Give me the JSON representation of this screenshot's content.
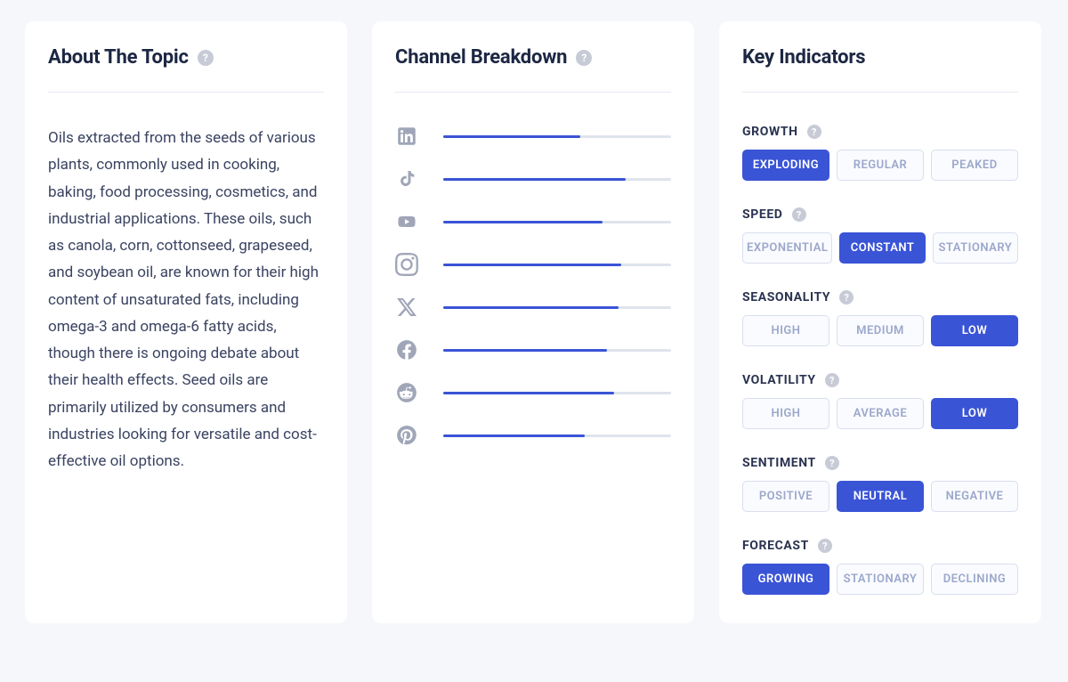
{
  "about": {
    "title": "About The Topic",
    "body": "Oils extracted from the seeds of various plants, commonly used in cooking, baking, food processing, cosmetics, and industrial applications. These oils, such as canola, corn, cottonseed, grapeseed, and soybean oil, are known for their high content of unsaturated fats, including omega-3 and omega-6 fatty acids, though there is ongoing debate about their health effects. Seed oils are primarily utilized by consumers and industries looking for versatile and cost-effective oil options."
  },
  "channels": {
    "title": "Channel Breakdown",
    "items": [
      {
        "name": "linkedin",
        "pct": 60
      },
      {
        "name": "tiktok",
        "pct": 80
      },
      {
        "name": "youtube",
        "pct": 70
      },
      {
        "name": "instagram",
        "pct": 78
      },
      {
        "name": "x",
        "pct": 77
      },
      {
        "name": "facebook",
        "pct": 72
      },
      {
        "name": "reddit",
        "pct": 75
      },
      {
        "name": "pinterest",
        "pct": 62
      }
    ]
  },
  "indicators": {
    "title": "Key Indicators",
    "groups": [
      {
        "label": "GROWTH",
        "options": [
          "EXPLODING",
          "REGULAR",
          "PEAKED"
        ],
        "active": 0
      },
      {
        "label": "SPEED",
        "options": [
          "EXPONENTIAL",
          "CONSTANT",
          "STATIONARY"
        ],
        "active": 1
      },
      {
        "label": "SEASONALITY",
        "options": [
          "HIGH",
          "MEDIUM",
          "LOW"
        ],
        "active": 2
      },
      {
        "label": "VOLATILITY",
        "options": [
          "HIGH",
          "AVERAGE",
          "LOW"
        ],
        "active": 2
      },
      {
        "label": "SENTIMENT",
        "options": [
          "POSITIVE",
          "NEUTRAL",
          "NEGATIVE"
        ],
        "active": 1
      },
      {
        "label": "FORECAST",
        "options": [
          "GROWING",
          "STATIONARY",
          "DECLINING"
        ],
        "active": 0
      }
    ]
  }
}
